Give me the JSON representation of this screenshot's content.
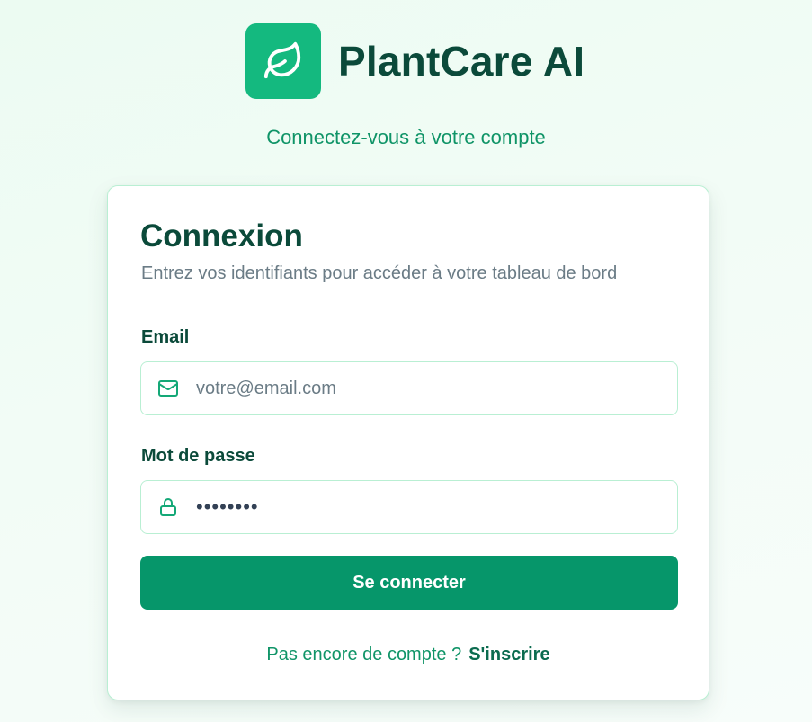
{
  "brand": {
    "name": "PlantCare AI",
    "logo_icon": "leaf-icon",
    "logo_color": "#14b97f"
  },
  "tagline": "Connectez-vous à votre compte",
  "login": {
    "title": "Connexion",
    "subtitle": "Entrez vos identifiants pour accéder à votre tableau de bord",
    "email": {
      "label": "Email",
      "placeholder": "votre@email.com",
      "value": "",
      "icon": "mail-icon"
    },
    "password": {
      "label": "Mot de passe",
      "value": "••••••••",
      "icon": "lock-icon"
    },
    "submit_label": "Se connecter",
    "signup_prompt": "Pas encore de compte ?",
    "signup_link": "S'inscrire"
  },
  "colors": {
    "accent": "#06966a",
    "heading": "#0b4a3a",
    "border": "#b9efd3"
  }
}
